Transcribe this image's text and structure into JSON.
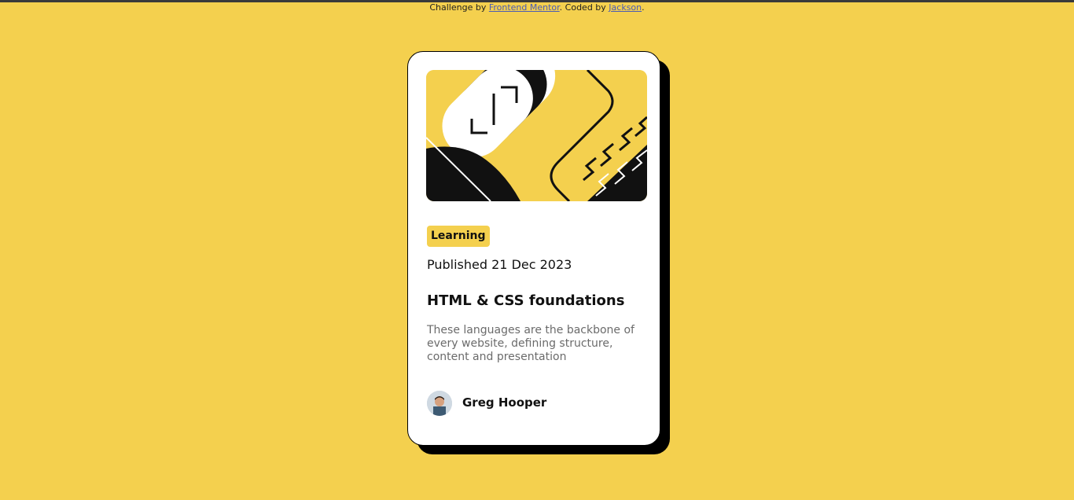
{
  "attribution": {
    "prefix": "Challenge by ",
    "mentor_link": "Frontend Mentor",
    "middle": ". Coded by ",
    "author_link": "Jackson",
    "suffix": "."
  },
  "card": {
    "badge": "Learning",
    "published": "Published 21 Dec 2023",
    "title": "HTML & CSS foundations",
    "description": "These languages are the backbone of every website, defining structure, content and presentation",
    "author_name": "Greg Hooper"
  },
  "colors": {
    "background": "#F4D04E",
    "card": "#FFFFFF",
    "shadow": "#000000",
    "text": "#111111",
    "muted": "#6B6B6B"
  },
  "icons": {
    "hero_illustration": "abstract-illustration",
    "avatar": "author-avatar"
  }
}
